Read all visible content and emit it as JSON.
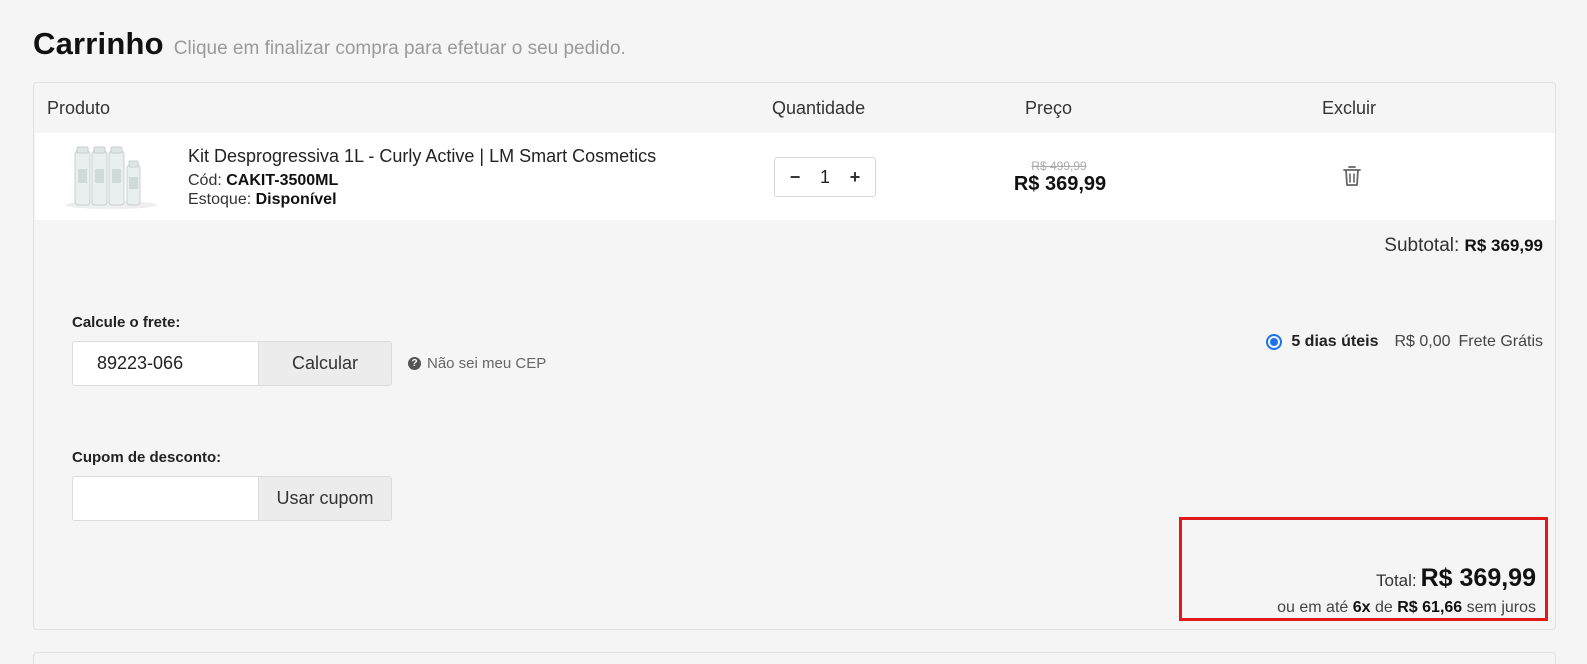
{
  "header": {
    "title": "Carrinho",
    "subtitle": "Clique em finalizar compra para efetuar o seu pedido."
  },
  "table": {
    "columns": {
      "product": "Produto",
      "quantity": "Quantidade",
      "price": "Preço",
      "delete": "Excluir"
    }
  },
  "item": {
    "name": "Kit Desprogressiva 1L - Curly Active | LM Smart Cosmetics",
    "code_label": "Cód:",
    "code": "CAKIT-3500ML",
    "stock_label": "Estoque:",
    "stock": "Disponível",
    "quantity": "1",
    "qty_minus": "−",
    "qty_plus": "+",
    "price_old": "R$ 499,99",
    "price_new": "R$ 369,99"
  },
  "subtotal": {
    "label": "Subtotal:",
    "value": "R$ 369,99"
  },
  "shipping": {
    "label": "Calcule o frete:",
    "cep_value": "89223-066",
    "calc_button": "Calcular",
    "help_text": "Não sei meu CEP",
    "option": {
      "days": "5 dias úteis",
      "price": "R$ 0,00",
      "name": "Frete Grátis",
      "selected": true
    }
  },
  "coupon": {
    "label": "Cupom de desconto:",
    "value": "",
    "button": "Usar cupom"
  },
  "total": {
    "label": "Total:",
    "value": "R$ 369,99",
    "install_prefix": "ou em até",
    "install_count": "6x",
    "install_of": "de",
    "install_value": "R$ 61,66",
    "install_suffix": "sem juros"
  },
  "colors": {
    "highlight_border": "#e0191b",
    "radio_accent": "#1a73e8"
  }
}
